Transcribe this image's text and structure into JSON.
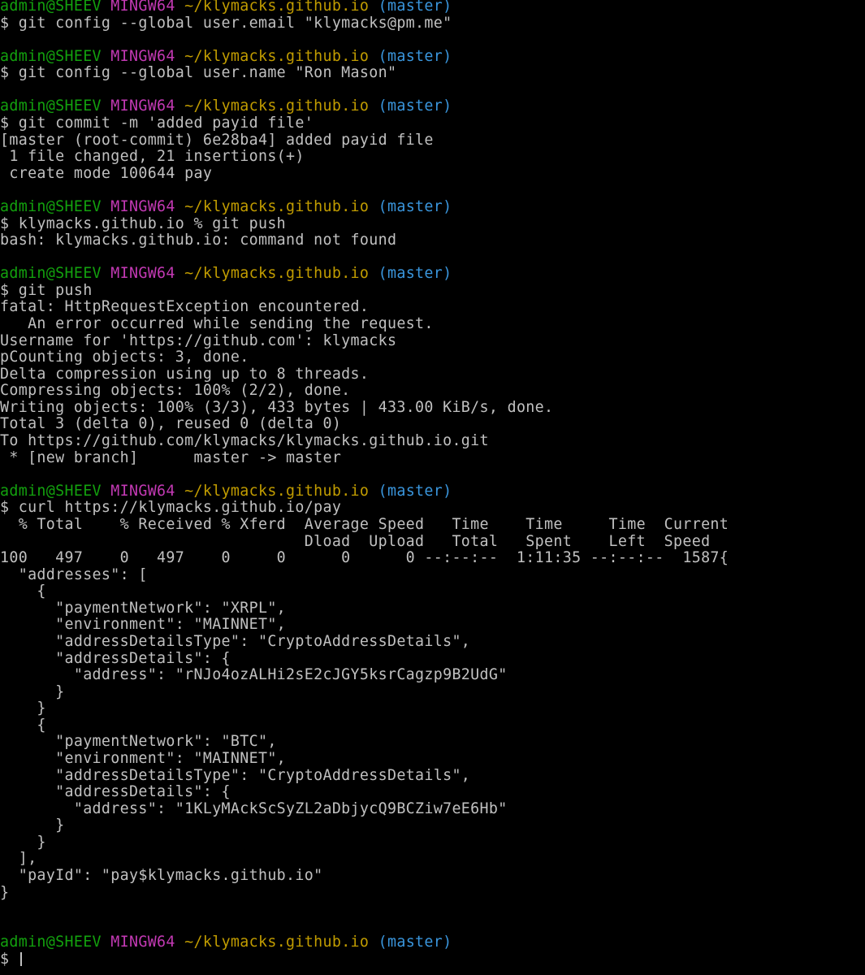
{
  "prompt": {
    "user_host": "admin@SHEEV",
    "system": "MINGW64",
    "path": "~/klymacks.github.io",
    "branch": "(master)"
  },
  "lines": [
    {
      "type": "prompt"
    },
    {
      "type": "text",
      "text": "$ git config --global user.email \"klymacks@pm.me\""
    },
    {
      "type": "blank"
    },
    {
      "type": "prompt"
    },
    {
      "type": "text",
      "text": "$ git config --global user.name \"Ron Mason\""
    },
    {
      "type": "blank"
    },
    {
      "type": "prompt"
    },
    {
      "type": "text",
      "text": "$ git commit -m 'added payid file'"
    },
    {
      "type": "text",
      "text": "[master (root-commit) 6e28ba4] added payid file"
    },
    {
      "type": "text",
      "text": " 1 file changed, 21 insertions(+)"
    },
    {
      "type": "text",
      "text": " create mode 100644 pay"
    },
    {
      "type": "blank"
    },
    {
      "type": "prompt"
    },
    {
      "type": "text",
      "text": "$ klymacks.github.io % git push"
    },
    {
      "type": "text",
      "text": "bash: klymacks.github.io: command not found"
    },
    {
      "type": "blank"
    },
    {
      "type": "prompt"
    },
    {
      "type": "text",
      "text": "$ git push"
    },
    {
      "type": "text",
      "text": "fatal: HttpRequestException encountered."
    },
    {
      "type": "text",
      "text": "   An error occurred while sending the request."
    },
    {
      "type": "text",
      "text": "Username for 'https://github.com': klymacks"
    },
    {
      "type": "text",
      "text": "pCounting objects: 3, done."
    },
    {
      "type": "text",
      "text": "Delta compression using up to 8 threads."
    },
    {
      "type": "text",
      "text": "Compressing objects: 100% (2/2), done."
    },
    {
      "type": "text",
      "text": "Writing objects: 100% (3/3), 433 bytes | 433.00 KiB/s, done."
    },
    {
      "type": "text",
      "text": "Total 3 (delta 0), reused 0 (delta 0)"
    },
    {
      "type": "text",
      "text": "To https://github.com/klymacks/klymacks.github.io.git"
    },
    {
      "type": "text",
      "text": " * [new branch]      master -> master"
    },
    {
      "type": "blank"
    },
    {
      "type": "prompt"
    },
    {
      "type": "text",
      "text": "$ curl https://klymacks.github.io/pay"
    },
    {
      "type": "text",
      "text": "  % Total    % Received % Xferd  Average Speed   Time    Time     Time  Current"
    },
    {
      "type": "text",
      "text": "                                 Dload  Upload   Total   Spent    Left  Speed"
    },
    {
      "type": "text",
      "text": "100   497    0   497    0     0      0      0 --:--:--  1:11:35 --:--:--  1587{"
    },
    {
      "type": "text",
      "text": "  \"addresses\": ["
    },
    {
      "type": "text",
      "text": "    {"
    },
    {
      "type": "text",
      "text": "      \"paymentNetwork\": \"XRPL\","
    },
    {
      "type": "text",
      "text": "      \"environment\": \"MAINNET\","
    },
    {
      "type": "text",
      "text": "      \"addressDetailsType\": \"CryptoAddressDetails\","
    },
    {
      "type": "text",
      "text": "      \"addressDetails\": {"
    },
    {
      "type": "text",
      "text": "        \"address\": \"rNJo4ozALHi2sE2cJGY5ksrCagzp9B2UdG\""
    },
    {
      "type": "text",
      "text": "      }"
    },
    {
      "type": "text",
      "text": "    }"
    },
    {
      "type": "text",
      "text": "    {"
    },
    {
      "type": "text",
      "text": "      \"paymentNetwork\": \"BTC\","
    },
    {
      "type": "text",
      "text": "      \"environment\": \"MAINNET\","
    },
    {
      "type": "text",
      "text": "      \"addressDetailsType\": \"CryptoAddressDetails\","
    },
    {
      "type": "text",
      "text": "      \"addressDetails\": {"
    },
    {
      "type": "text",
      "text": "        \"address\": \"1KLyMAckScSyZL2aDbjycQ9BCZiw7eE6Hb\""
    },
    {
      "type": "text",
      "text": "      }"
    },
    {
      "type": "text",
      "text": "    }"
    },
    {
      "type": "text",
      "text": "  ],"
    },
    {
      "type": "text",
      "text": "  \"payId\": \"pay$klymacks.github.io\""
    },
    {
      "type": "text",
      "text": "}"
    },
    {
      "type": "blank"
    },
    {
      "type": "blank"
    },
    {
      "type": "prompt"
    },
    {
      "type": "input",
      "text": "$ "
    }
  ],
  "colors": {
    "background": "#000000",
    "foreground": "#c0c0c0",
    "user_host": "#13a10e",
    "system": "#c239b3",
    "path": "#c19c00",
    "branch": "#3a96dd"
  }
}
